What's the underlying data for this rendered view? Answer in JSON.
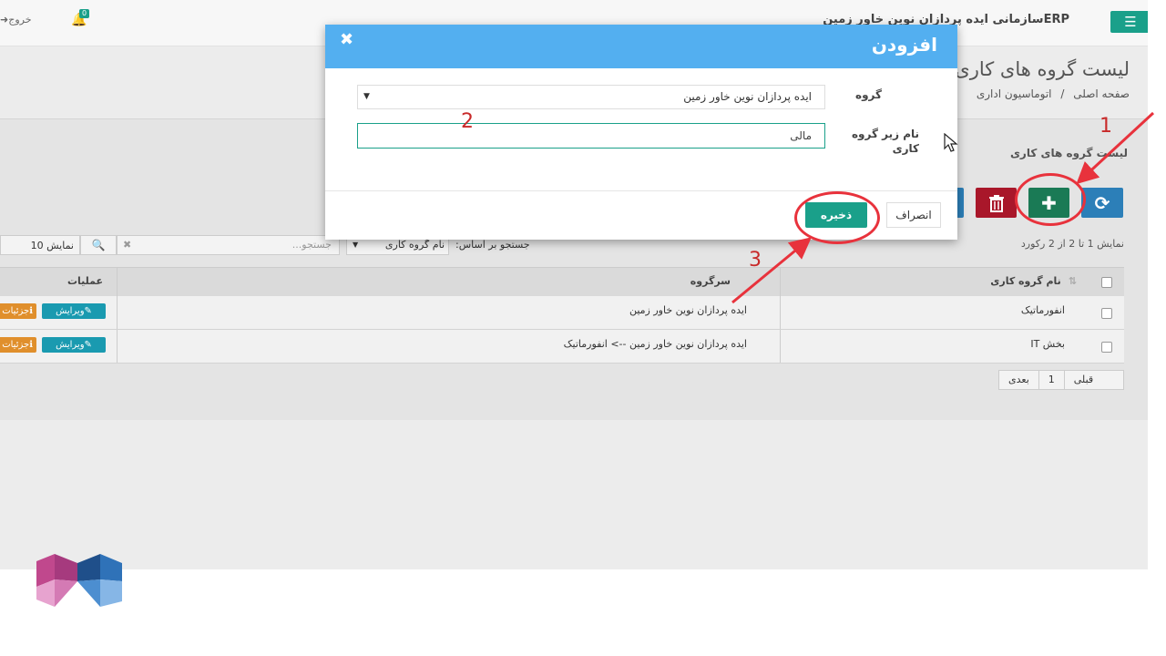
{
  "header": {
    "app_title": "ERPسازمانی ایده پردازان نوین خاور زمین",
    "notification_count": "0",
    "logout_label": "خروج",
    "menu_icon": "hamburger-icon",
    "bell_icon": "bell-icon",
    "logout_icon": "sign-out-icon"
  },
  "page": {
    "title": "لیست گروه های کاری",
    "breadcrumb": [
      "صفحه اصلی",
      "/",
      "اتوماسیون اداری"
    ]
  },
  "box": {
    "title": "لیست گروه های کاری",
    "toolbar_icons": [
      "refresh-icon",
      "plus-icon",
      "trash-icon"
    ]
  },
  "list": {
    "record_count": "نمایش 1 تا 2 از 2 رکورد",
    "search_by_label": "جستجو بر اساس:",
    "search_field": "نام گروه کاری",
    "search_placeholder": "جستجو...",
    "show_label": "نمایش",
    "show_value": "10",
    "columns": {
      "name": "نام گروه کاری",
      "parent": "سرگروه",
      "actions": "عملیات"
    },
    "rows": [
      {
        "name": "انفورماتیک",
        "parent": "ایده پردازان نوین خاور زمین",
        "edit": "ویرایش",
        "detail": "جزئیات"
      },
      {
        "name": "بخش IT",
        "parent": "ایده پردازان نوین خاور زمین --> انفورماتیک",
        "edit": "ویرایش",
        "detail": "جزئیات"
      }
    ],
    "pagination": [
      "قبلی",
      "1",
      "بعدی"
    ]
  },
  "modal": {
    "title": "افزودن",
    "close_symbol": "✖",
    "group_label": "گروه",
    "group_value": "ایده پردازان نوین خاور زمین",
    "subgroup_label_line1": "نام زیر گروه",
    "subgroup_label_line2": "کاری",
    "subgroup_value": "مالی",
    "cancel_label": "انصراف",
    "save_label": "ذخیره"
  },
  "annotations": {
    "step1": "1",
    "step2": "2",
    "step3": "3",
    "color": "#e8323c"
  },
  "colors": {
    "teal": "#1aa08a",
    "modal_header": "#53aff0",
    "blue_button": "#2c7fb8",
    "green_button": "#1a7a55",
    "red_button": "#a9172a"
  }
}
